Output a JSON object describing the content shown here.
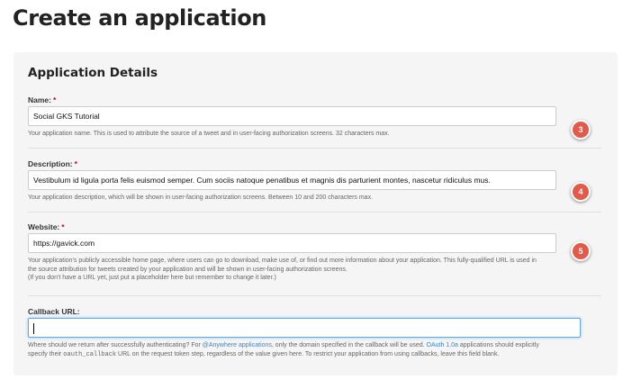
{
  "page": {
    "title": "Create an application"
  },
  "section": {
    "title": "Application Details"
  },
  "fields": {
    "name": {
      "label": "Name:",
      "required_mark": "*",
      "value": "Social GKS Tutorial",
      "help": "Your application name. This is used to attribute the source of a tweet and in user-facing authorization screens. 32 characters max.",
      "badge": "3"
    },
    "description": {
      "label": "Description:",
      "required_mark": "*",
      "value": "Vestibulum id ligula porta felis euismod semper. Cum sociis natoque penatibus et magnis dis parturient montes, nascetur ridiculus mus.",
      "help": "Your application description, which will be shown in user-facing authorization screens. Between 10 and 200 characters max.",
      "badge": "4"
    },
    "website": {
      "label": "Website:",
      "required_mark": "*",
      "value": "https://gavick.com",
      "help_line1": "Your application's publicly accessible home page, where users can go to download, make use of, or find out more information about your application. This fully-qualified URL is used in",
      "help_line2": "the source attribution for tweets created by your application and will be shown in user-facing authorization screens.",
      "help_line3": "(If you don't have a URL yet, just put a placeholder here but remember to change it later.)",
      "badge": "5"
    },
    "callback": {
      "label": "Callback URL:",
      "value": "",
      "help_part1": "Where should we return after successfully authenticating? For ",
      "help_link1": "@Anywhere applications",
      "help_part2": ", only the domain specified in the callback will be used. ",
      "help_link2": "OAuth 1.0a",
      "help_part3": " applications should explicitly",
      "help_part4": "specify their ",
      "help_code": "oauth_callback",
      "help_part5": " URL on the request token step, regardless of the value given here. To restrict your application from using callbacks, leave this field blank."
    }
  },
  "colors": {
    "badge": "#e35a4a",
    "link": "#3a87c8",
    "required": "#cc0033",
    "focus_border": "#66a8e0"
  }
}
